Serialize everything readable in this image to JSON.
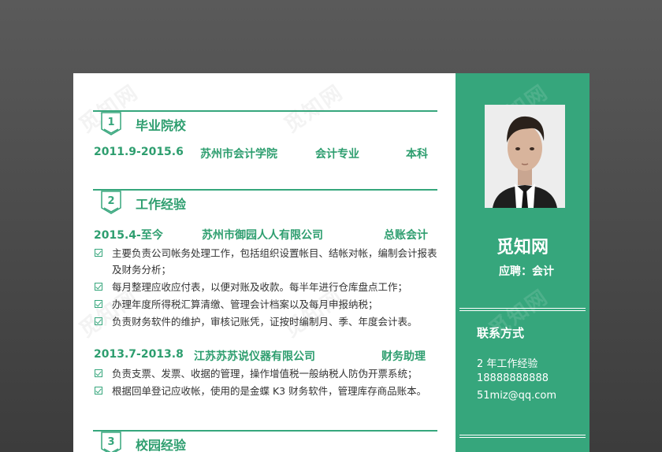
{
  "watermark": "觅知网",
  "sections": {
    "education": {
      "num": "1",
      "title": "毕业院校"
    },
    "work": {
      "num": "2",
      "title": "工作经验"
    },
    "campus": {
      "num": "3",
      "title": "校园经验"
    }
  },
  "education": {
    "date": "2011.9-2015.6",
    "school": "苏州市会计学院",
    "major": "会计专业",
    "degree": "本科"
  },
  "jobs": [
    {
      "date": "2015.4-至今",
      "company": "苏州市御园人人有限公司",
      "position": "总账会计",
      "bullets": [
        "主要负责公司帐务处理工作，包括组织设置帐目、结帐对帐，编制会计报表及财务分析；",
        "每月整理应收应付表，以便对账及收款。每半年进行仓库盘点工作；",
        "办理年度所得税汇算清缴、管理会计档案以及每月申报纳税；",
        "负责财务软件的维护，审核记账凭，证按时编制月、季、年度会计表。"
      ]
    },
    {
      "date": "2013.7-2013.8",
      "company": "江苏苏苏说仪器有限公司",
      "position": "财务助理",
      "bullets": [
        "负责支票、发票、收据的管理，操作增值税一般纳税人防伪开票系统；",
        "根据回单登记应收帐，使用的是金蝶 K3 财务软件，管理库存商品账本。"
      ]
    }
  ],
  "profile": {
    "name": "觅知网",
    "job": "应聘：会计"
  },
  "contact": {
    "title": "联系方式",
    "experience": "2 年工作经验",
    "phone": "18888888888",
    "email": "51miz@qq.com"
  },
  "colors": {
    "accent": "#36a67c",
    "text": "#333333",
    "background": "#4a4a4a"
  },
  "icons": {
    "bullet": "checkbox-icon",
    "badge": "shield-badge-icon"
  }
}
